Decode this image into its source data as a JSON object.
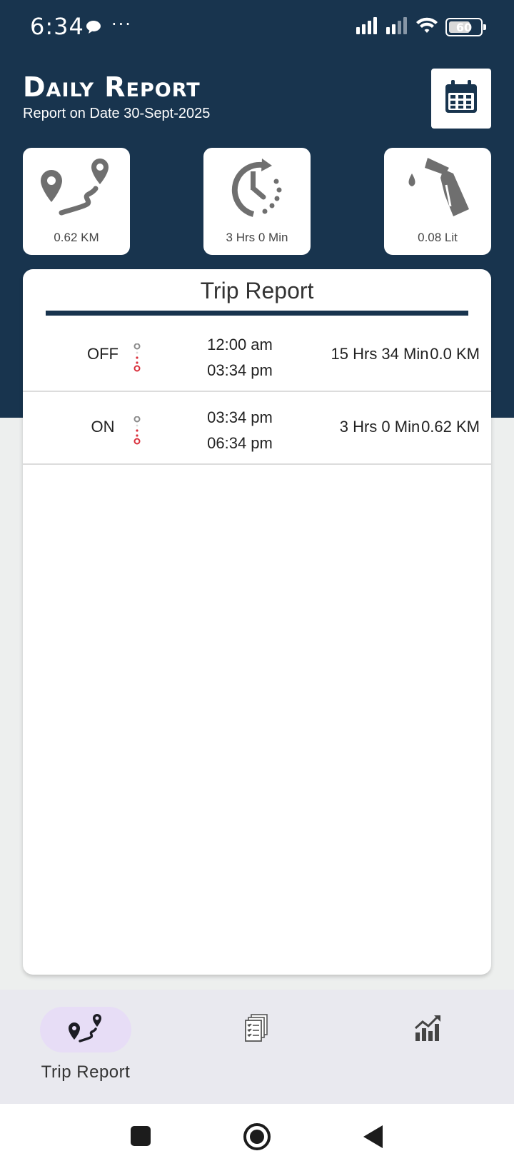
{
  "status_bar": {
    "time": "6:34",
    "dots": "···",
    "battery": "60"
  },
  "header": {
    "title": "Daily Report",
    "subtitle": "Report on Date 30-Sept-2025"
  },
  "stats": [
    {
      "icon": "route-icon",
      "value": "0.62 KM"
    },
    {
      "icon": "clock-icon",
      "value": "3 Hrs 0 Min"
    },
    {
      "icon": "fuel-nozzle-icon",
      "value": "0.08 Lit"
    }
  ],
  "trip_report": {
    "title": "Trip Report",
    "rows": [
      {
        "status": "OFF",
        "start": "12:00 am",
        "end": "03:34 pm",
        "duration": "15 Hrs 34 Min",
        "distance": "0.0 KM"
      },
      {
        "status": "ON",
        "start": "03:34 pm",
        "end": "06:34 pm",
        "duration": "3 Hrs 0 Min",
        "distance": "0.62 KM"
      }
    ]
  },
  "bottom_nav": {
    "items": [
      {
        "label": "Trip Report",
        "icon": "route-icon",
        "active": true
      },
      {
        "label": "",
        "icon": "documents-icon",
        "active": false
      },
      {
        "label": "",
        "icon": "chart-growth-icon",
        "active": false
      }
    ]
  },
  "colors": {
    "header_bg": "#18344e",
    "accent": "#18344e",
    "pill": "#e7ddf6",
    "end_marker": "#d9303c"
  }
}
